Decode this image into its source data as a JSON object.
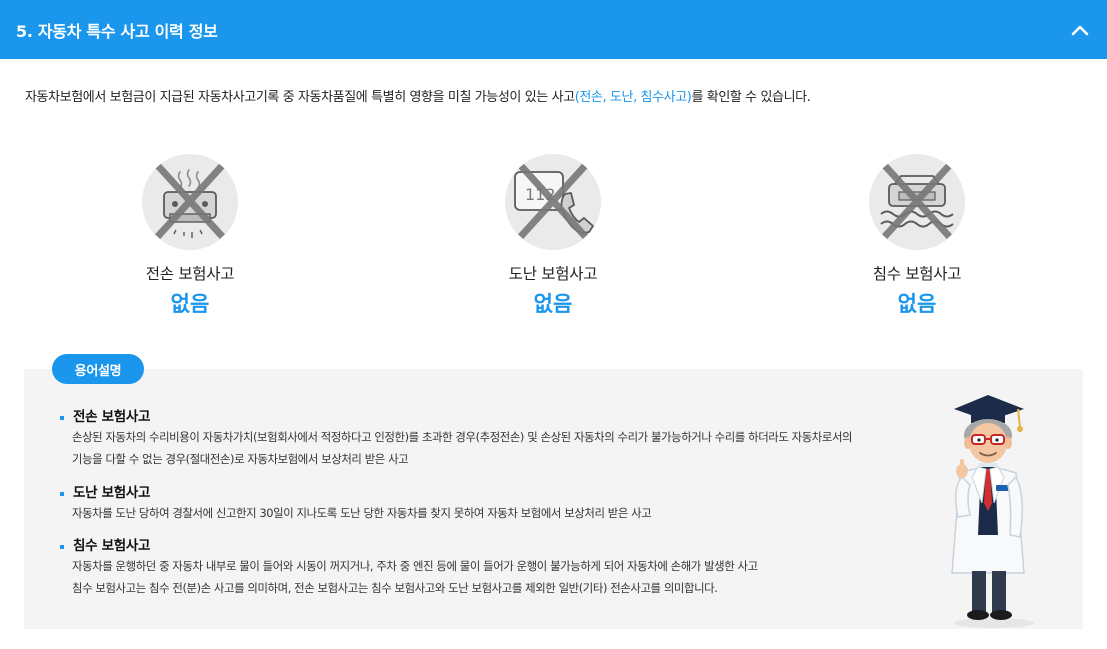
{
  "header": {
    "title": "5. 자동차 특수 사고 이력 정보",
    "collapse_icon": "chevron-up-icon"
  },
  "intro": {
    "before": "자동차보험에서 보험금이 지급된 자동차사고기록 중 자동차품질에 특별히 영향을 미칠 가능성이 있는 사고",
    "highlight": "(전손, 도난, 침수사고)",
    "after": "를 확인할 수 있습니다."
  },
  "accidents": [
    {
      "label": "전손 보험사고",
      "value": "없음",
      "icon": "total-loss-car-icon"
    },
    {
      "label": "도난 보험사고",
      "value": "없음",
      "icon": "theft-phone-icon"
    },
    {
      "label": "침수 보험사고",
      "value": "없음",
      "icon": "flood-car-icon"
    }
  ],
  "glossary": {
    "badge": "용어설명",
    "terms": [
      {
        "title": "전손 보험사고",
        "lines": [
          "손상된 자동차의 수리비용이 자동차가치(보험회사에서 적정하다고 인정한)를 초과한 경우(추정전손) 및 손상된 자동차의 수리가 불가능하거나 수리를 하더라도 자동차로서의",
          "기능을 다할 수 없는 경우(절대전손)로 자동차보험에서 보상처리 받은 사고"
        ]
      },
      {
        "title": "도난 보험사고",
        "lines": [
          "자동차를 도난 당하여 경찰서에 신고한지 30일이 지나도록 도난 당한 자동차를 찾지 못하여 자동차 보험에서 보상처리 받은 사고"
        ]
      },
      {
        "title": "침수 보험사고",
        "lines": [
          "자동차를 운행하던 중 자동차 내부로 물이 들어와 시동이 꺼지거나, 주차 중 엔진 등에 물이 들어가 운행이 불가능하게 되어 자동차에 손해가 발생한 사고",
          "침수 보험사고는 침수 전(분)손 사고를 의미하며, 전손 보험사고는 침수 보험사고와 도난 보험사고를 제외한 일반(기타) 전손사고를 의미합니다."
        ]
      }
    ],
    "character": "professor-character-icon"
  },
  "colors": {
    "accent": "#1a96ec",
    "panel": "#f4f4f4",
    "icon_circle": "#eaeaea",
    "cross": "#7a7a7a"
  }
}
